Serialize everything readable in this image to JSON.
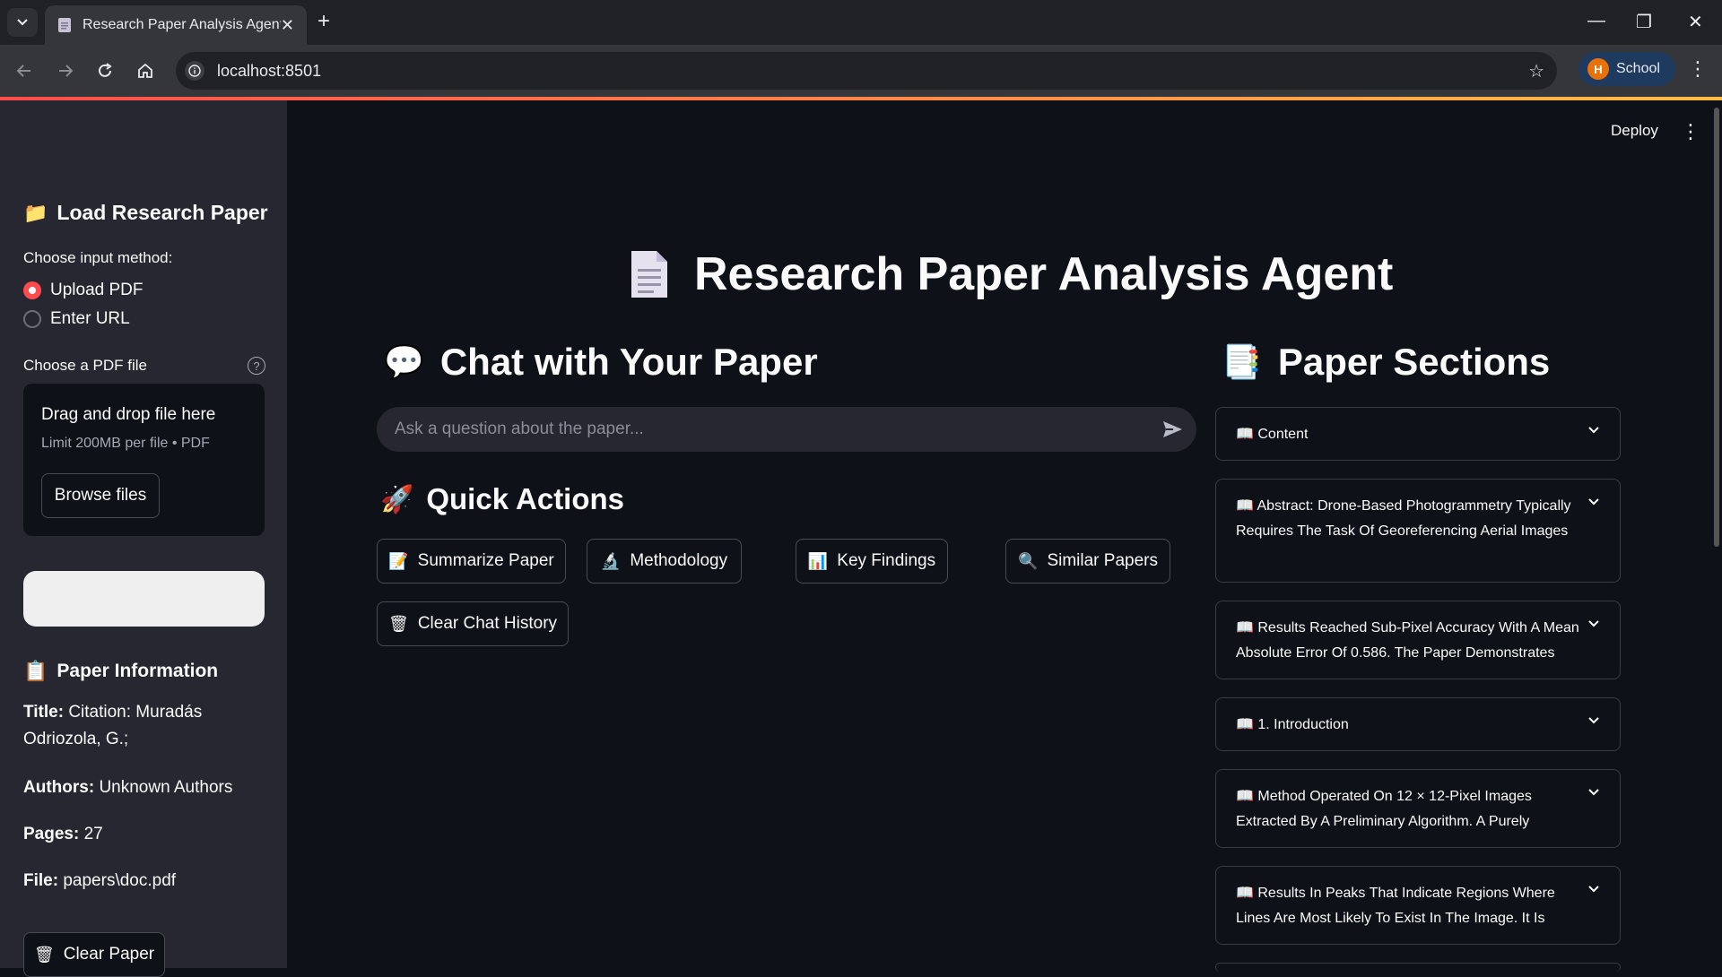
{
  "browser": {
    "tab_title": "Research Paper Analysis Agent",
    "url": "localhost:8501",
    "profile_initial": "H",
    "profile_name": "School"
  },
  "app": {
    "deploy_label": "Deploy",
    "title": "Research Paper Analysis Agent"
  },
  "sidebar": {
    "load_heading": "Load Research Paper",
    "input_method_label": "Choose input method:",
    "radio_options": [
      "Upload PDF",
      "Enter URL"
    ],
    "selected_option": "Upload PDF",
    "file_label": "Choose a PDF file",
    "dropzone_title": "Drag and drop file here",
    "dropzone_limit": "Limit 200MB per file • PDF",
    "browse_label": "Browse files",
    "info_heading": "Paper Information",
    "info": {
      "title_key": "Title:",
      "title_val": "Citation: Muradás Odriozola, G.;",
      "authors_key": "Authors:",
      "authors_val": "Unknown Authors",
      "pages_key": "Pages:",
      "pages_val": "27",
      "file_key": "File:",
      "file_val": "papers\\doc.pdf"
    },
    "clear_paper_label": "Clear Paper"
  },
  "chat": {
    "heading": "Chat with Your Paper",
    "placeholder": "Ask a question about the paper..."
  },
  "quick_actions": {
    "heading": "Quick Actions",
    "summarize": "Summarize Paper",
    "methodology": "Methodology",
    "key_findings": "Key Findings",
    "similar": "Similar Papers",
    "clear_chat": "Clear Chat History"
  },
  "sections": {
    "heading": "Paper Sections",
    "items": [
      "Content",
      "Abstract: Drone-Based Photogrammetry Typically Requires The Task Of Georeferencing Aerial Images",
      "Results Reached Sub-Pixel Accuracy With A Mean Absolute Error Of 0.586. The Paper Demonstrates",
      "1. Introduction",
      "Method Operated On 12 × 12-Pixel Images Extracted By A Preliminary Algorithm. A Purely",
      "Results In Peaks That Indicate Regions Where Lines Are Most Likely To Exist In The Image. It Is"
    ]
  }
}
